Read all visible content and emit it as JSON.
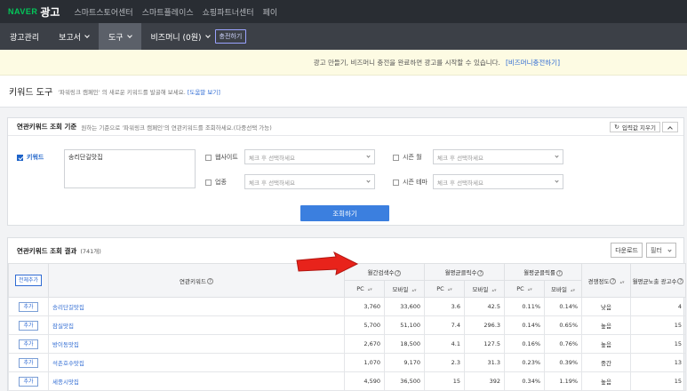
{
  "topbar": {
    "logo_naver": "NAVER",
    "logo_ad": "광고",
    "links": [
      "스마트스토어센터",
      "스마트플레이스",
      "쇼핑파트너센터",
      "페이"
    ]
  },
  "menu": {
    "items": [
      {
        "label": "광고관리",
        "dropdown": false,
        "active": false
      },
      {
        "label": "보고서",
        "dropdown": true,
        "active": false
      },
      {
        "label": "도구",
        "dropdown": true,
        "active": true
      },
      {
        "label": "비즈머니 (0원)",
        "dropdown": true,
        "active": false
      }
    ],
    "charge_label": "충전하기"
  },
  "notice": {
    "text": "광고 만들기, 비즈머니 충전을 완료하면 광고를 시작할 수 있습니다.",
    "link": "[비즈머니충전하기]"
  },
  "page": {
    "title": "키워드 도구",
    "subtitle": "'파워링크 캠페인' 의 새로운 키워드를 발굴해 보세요.",
    "help_link": "[도움말 보기]"
  },
  "search_panel": {
    "title": "연관키워드 조회 기준",
    "desc": "원하는 기준으로 '파워링크 캠페인'의 연관키워드를 조회하세요.(다중선택 가능)",
    "reset_label": "입력값 지우기",
    "keyword_label": "키워드",
    "keyword_value": "송리단길맛집",
    "website_label": "웹사이트",
    "industry_label": "업종",
    "season_month_label": "시즌 월",
    "season_theme_label": "시즌 테마",
    "select_placeholder": "체크 후 선택하세요",
    "search_button": "조회하기"
  },
  "results": {
    "title": "연관키워드 조회 결과",
    "count": "(741개)",
    "download_label": "다운로드",
    "filter_label": "필터",
    "add_all_label": "전체추가",
    "add_label": "추가",
    "headers": {
      "keyword": "연관키워드",
      "monthly_search": "월간검색수",
      "avg_clicks": "월평균클릭수",
      "avg_ctr": "월평균클릭률",
      "competition": "경쟁정도",
      "avg_ads": "월평균노출 광고수",
      "pc": "PC",
      "mobile": "모바일"
    },
    "rows": [
      {
        "keyword": "송리단길맛집",
        "search_pc": "3,760",
        "search_mobile": "33,600",
        "clicks_pc": "3.6",
        "clicks_mobile": "42.5",
        "ctr_pc": "0.11%",
        "ctr_mobile": "0.14%",
        "competition": "낮음",
        "ads": "4"
      },
      {
        "keyword": "잠실맛집",
        "search_pc": "5,700",
        "search_mobile": "51,100",
        "clicks_pc": "7.4",
        "clicks_mobile": "296.3",
        "ctr_pc": "0.14%",
        "ctr_mobile": "0.65%",
        "competition": "높음",
        "ads": "15"
      },
      {
        "keyword": "방이동맛집",
        "search_pc": "2,670",
        "search_mobile": "18,500",
        "clicks_pc": "4.1",
        "clicks_mobile": "127.5",
        "ctr_pc": "0.16%",
        "ctr_mobile": "0.76%",
        "competition": "높음",
        "ads": "15"
      },
      {
        "keyword": "석촌호수맛집",
        "search_pc": "1,070",
        "search_mobile": "9,170",
        "clicks_pc": "2.3",
        "clicks_mobile": "31.3",
        "ctr_pc": "0.23%",
        "ctr_mobile": "0.39%",
        "competition": "중간",
        "ads": "13"
      },
      {
        "keyword": "세종시맛집",
        "search_pc": "4,590",
        "search_mobile": "36,500",
        "clicks_pc": "15",
        "clicks_mobile": "392",
        "ctr_pc": "0.34%",
        "ctr_mobile": "1.19%",
        "competition": "높음",
        "ads": "15"
      }
    ]
  },
  "colors": {
    "naver_green": "#03c75a",
    "topbar": "#292d33",
    "menubar": "#3c4047",
    "accent_blue": "#3b7fdf",
    "arrow_red": "#e8231b"
  }
}
